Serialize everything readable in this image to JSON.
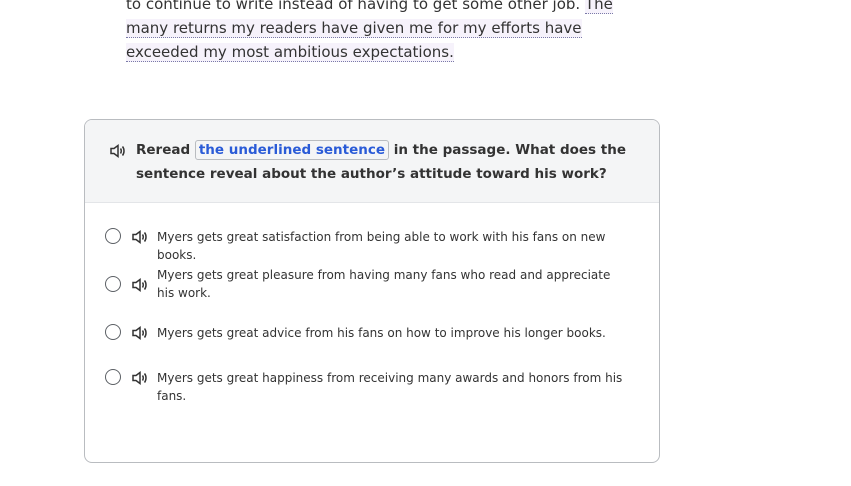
{
  "passage": {
    "text_before": "to continue to write instead of having to get some other job. ",
    "underlined": "The many returns my readers have given me for my efforts have exceeded my most ambitious expectations."
  },
  "question": {
    "prefix": "Reread ",
    "link": "the underlined sentence",
    "suffix": " in the passage. What does the sentence reveal about the author’s attitude toward his work?",
    "speaker_icon": "speaker-icon"
  },
  "options": [
    {
      "text": "Myers gets great satisfaction from being able to work with his fans on new books."
    },
    {
      "text": "Myers gets great pleasure from having many fans who read and appreciate his work."
    },
    {
      "text": "Myers gets great advice from his fans on how to improve his longer books."
    },
    {
      "text": "Myers gets great happiness from receiving many awards and honors from his fans."
    }
  ],
  "colors": {
    "link": "#2a5bd7",
    "header_bg": "#f4f5f6",
    "border": "#b9bcc0"
  }
}
